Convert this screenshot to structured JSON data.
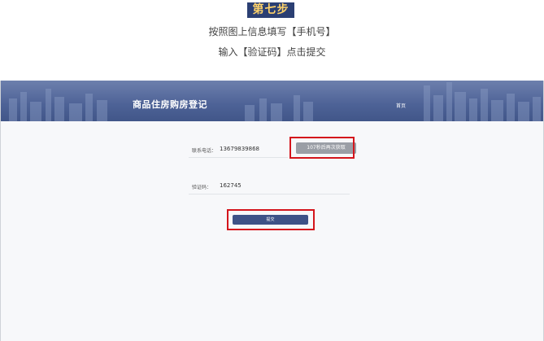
{
  "tutorial": {
    "step_label": "第七步",
    "instruction_line1": "按照图上信息填写【手机号】",
    "instruction_line2": "输入【验证码】点击提交"
  },
  "header": {
    "title": "商品住房购房登记",
    "home_link": "首页"
  },
  "form": {
    "phone_label": "联系电话：",
    "phone_value": "13679839868",
    "get_code_button": "107秒后再次获取",
    "code_label": "验证码：",
    "code_value": "162745",
    "submit_button": "提交"
  },
  "colors": {
    "banner": "#4d6296",
    "highlight": "#d4151c",
    "submit": "#3e5287"
  }
}
